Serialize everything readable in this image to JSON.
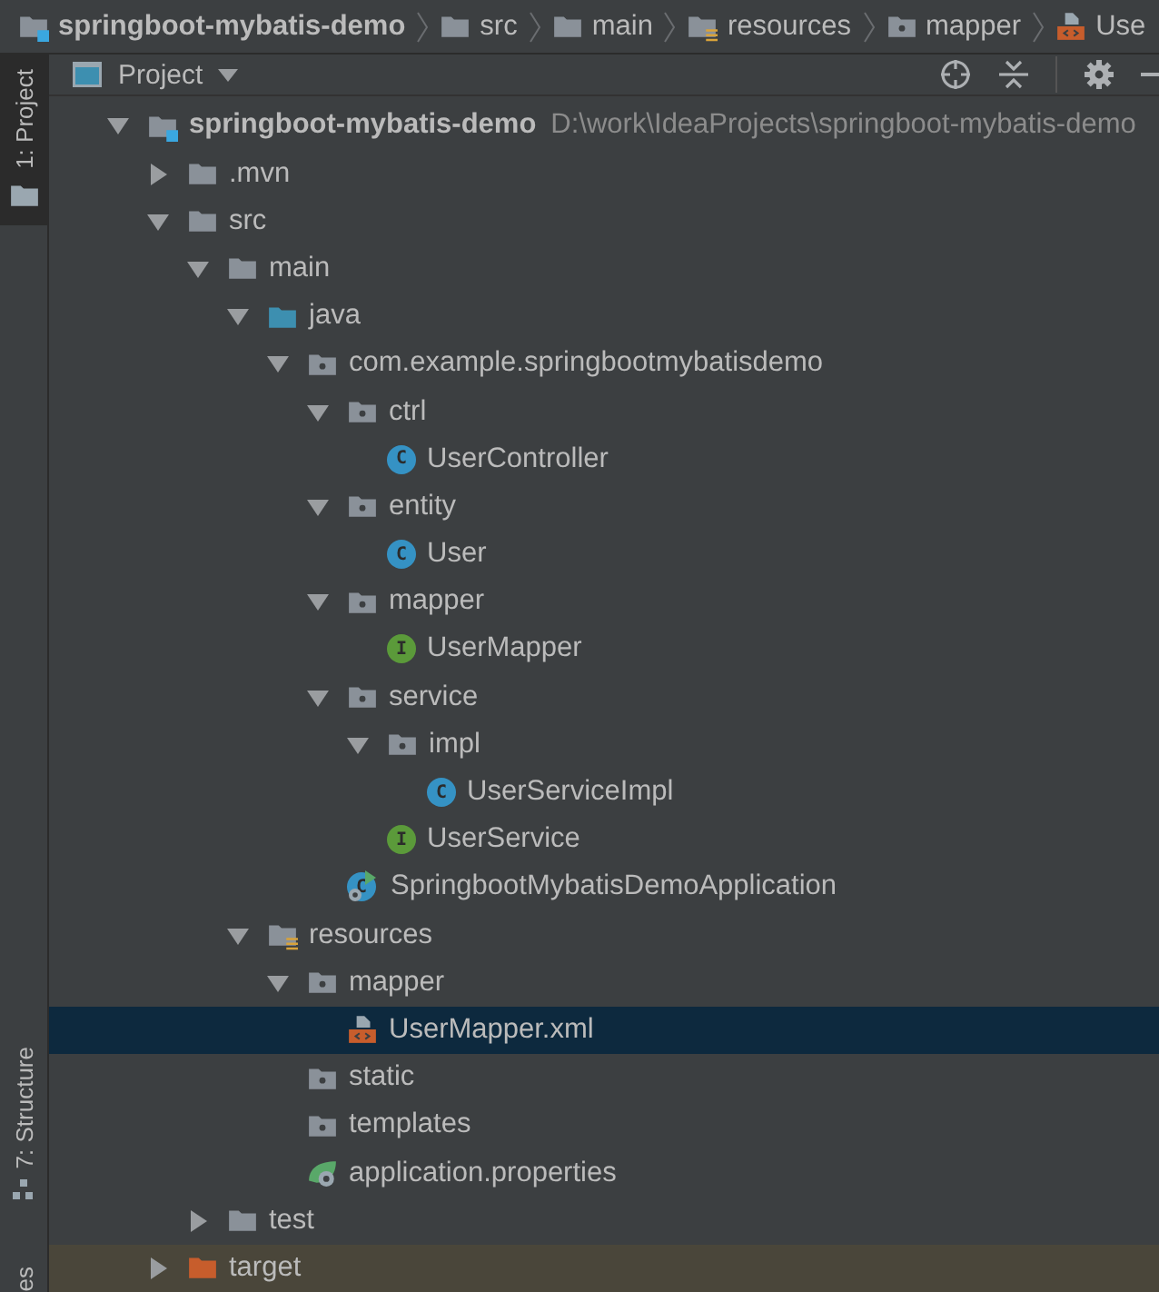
{
  "breadcrumbs": [
    {
      "label": "springboot-mybatis-demo",
      "kind": "module"
    },
    {
      "label": "src",
      "kind": "folder"
    },
    {
      "label": "main",
      "kind": "folder"
    },
    {
      "label": "resources",
      "kind": "resources"
    },
    {
      "label": "mapper",
      "kind": "package"
    },
    {
      "label": "Use",
      "kind": "xml"
    }
  ],
  "side_tabs": [
    {
      "label": "1: Project",
      "kind": "project",
      "selected": true
    },
    {
      "label": "7: Structure",
      "kind": "structure",
      "selected": false
    },
    {
      "label": "es",
      "kind": "plain",
      "selected": false
    }
  ],
  "panel": {
    "title": "Project"
  },
  "tree": [
    {
      "label": "springboot-mybatis-demo",
      "path": "D:\\work\\IdeaProjects\\springboot-mybatis-demo",
      "kind": "module",
      "expanded": true,
      "selected": false,
      "children": [
        {
          "label": ".mvn",
          "kind": "folder",
          "expanded": false,
          "selected": false
        },
        {
          "label": "src",
          "kind": "folder",
          "expanded": true,
          "selected": false,
          "children": [
            {
              "label": "main",
              "kind": "folder",
              "expanded": true,
              "selected": false,
              "children": [
                {
                  "label": "java",
                  "kind": "source",
                  "expanded": true,
                  "selected": false,
                  "children": [
                    {
                      "label": "com.example.springbootmybatisdemo",
                      "kind": "package",
                      "expanded": true,
                      "selected": false,
                      "children": [
                        {
                          "label": "ctrl",
                          "kind": "package",
                          "expanded": true,
                          "selected": false,
                          "children": [
                            {
                              "label": "UserController",
                              "kind": "class",
                              "badge": "C",
                              "selected": false
                            }
                          ]
                        },
                        {
                          "label": "entity",
                          "kind": "package",
                          "expanded": true,
                          "selected": false,
                          "children": [
                            {
                              "label": "User",
                              "kind": "class",
                              "badge": "C",
                              "selected": false
                            }
                          ]
                        },
                        {
                          "label": "mapper",
                          "kind": "package",
                          "expanded": true,
                          "selected": false,
                          "children": [
                            {
                              "label": "UserMapper",
                              "kind": "interface",
                              "badge": "I",
                              "selected": false
                            }
                          ]
                        },
                        {
                          "label": "service",
                          "kind": "package",
                          "expanded": true,
                          "selected": false,
                          "children": [
                            {
                              "label": "impl",
                              "kind": "package",
                              "expanded": true,
                              "selected": false,
                              "children": [
                                {
                                  "label": "UserServiceImpl",
                                  "kind": "class",
                                  "badge": "C",
                                  "selected": false
                                }
                              ]
                            },
                            {
                              "label": "UserService",
                              "kind": "interface",
                              "badge": "I",
                              "selected": false
                            }
                          ]
                        },
                        {
                          "label": "SpringbootMybatisDemoApplication",
                          "kind": "app",
                          "badge": "C",
                          "selected": false
                        }
                      ]
                    }
                  ]
                },
                {
                  "label": "resources",
                  "kind": "resources",
                  "expanded": true,
                  "selected": false,
                  "children": [
                    {
                      "label": "mapper",
                      "kind": "package",
                      "expanded": true,
                      "selected": false,
                      "children": [
                        {
                          "label": "UserMapper.xml",
                          "kind": "xml",
                          "selected": true
                        }
                      ]
                    },
                    {
                      "label": "static",
                      "kind": "package",
                      "selected": false
                    },
                    {
                      "label": "templates",
                      "kind": "package",
                      "selected": false
                    },
                    {
                      "label": "application.properties",
                      "kind": "spring",
                      "selected": false
                    }
                  ]
                }
              ]
            },
            {
              "label": "test",
              "kind": "folder",
              "expanded": false,
              "selected": false
            }
          ]
        },
        {
          "label": "target",
          "kind": "excluded",
          "expanded": false,
          "selected": false
        }
      ]
    }
  ]
}
